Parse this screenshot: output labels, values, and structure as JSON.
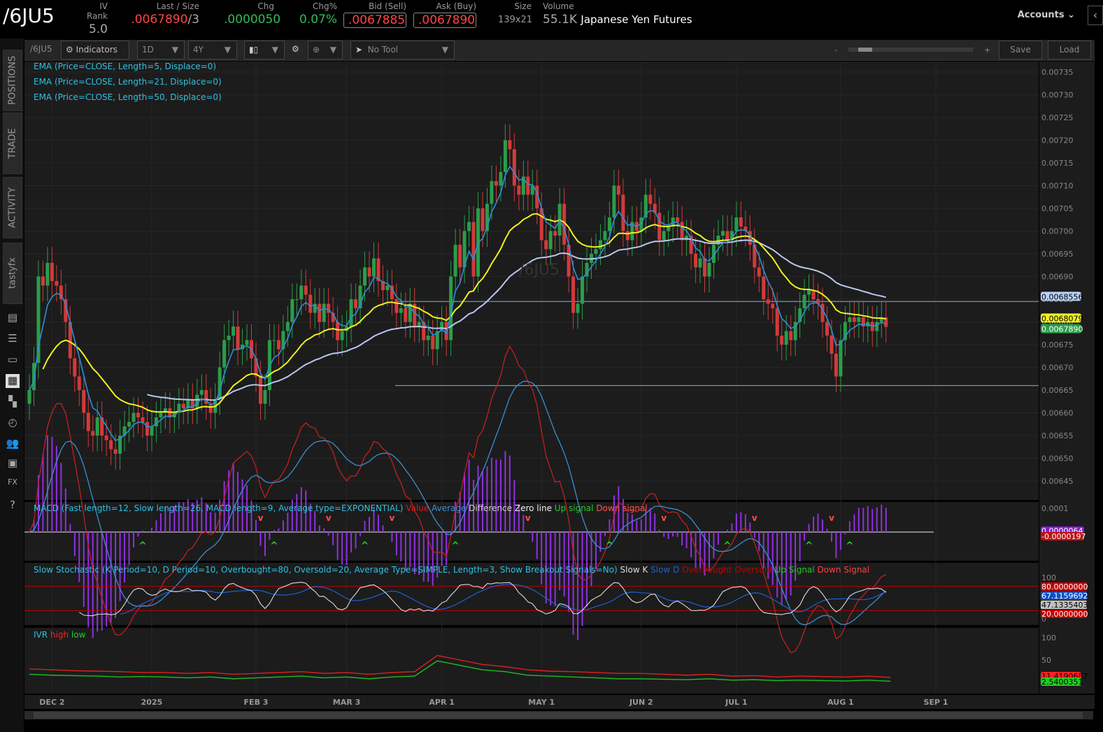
{
  "header": {
    "symbol": "/6JU5",
    "iv_rank_label": "IV Rank",
    "iv_rank": "5.0",
    "last_label": "Last / Size",
    "last": ".0067890",
    "last_size": "/3",
    "chg_label": "Chg",
    "chg": ".0000050",
    "chgp_label": "Chg%",
    "chgp": "0.07%",
    "bid_label": "Bid (Sell)",
    "bid": ".0067885",
    "ask_label": "Ask (Buy)",
    "ask": ".0067890",
    "size_label": "Size",
    "size": "139x21",
    "volume_label": "Volume",
    "volume": "55.1K",
    "description": "Japanese Yen Futures",
    "accounts": "Accounts"
  },
  "sidebar": {
    "tabs": [
      "POSITIONS",
      "TRADE",
      "ACTIVITY",
      "tastyfx"
    ],
    "icons": [
      "notes-icon",
      "list-icon",
      "monitor-icon",
      "chart-icon",
      "grid-icon",
      "clock-icon",
      "people-icon",
      "calendar-icon",
      "fx-icon",
      "help-icon"
    ]
  },
  "toolbar": {
    "symbol": "/6JU5",
    "indicators": "Indicators",
    "aggregation": "1D",
    "range": "4Y",
    "tool": "No Tool",
    "zoom_minus": "-",
    "zoom_plus": "+",
    "save": "Save",
    "load": "Load"
  },
  "studies": {
    "ema5": "EMA (Price=CLOSE, Length=5, Displace=0)",
    "ema21": "EMA (Price=CLOSE, Length=21, Displace=0)",
    "ema50": "EMA (Price=CLOSE, Length=50, Displace=0)",
    "watermark": "/6JU5"
  },
  "macd_legend": {
    "title": "MACD (Fast length=12, Slow length=26, MACD length=9, Average type=EXPONENTIAL)",
    "items": [
      {
        "t": "Value",
        "c": "#d02020"
      },
      {
        "t": "Average",
        "c": "#3a8fd0"
      },
      {
        "t": "Difference",
        "c": "#cccccc"
      },
      {
        "t": "Zero line",
        "c": "#eeeeee"
      },
      {
        "t": "Up signal",
        "c": "#22cc22"
      },
      {
        "t": "Down signal",
        "c": "#ff5050"
      }
    ]
  },
  "stoch_legend": {
    "title": "Slow Stochastic (K Period=10, D Period=10, Overbought=80, Oversold=20, Average Type=SIMPLE, Length=3, Show Breakout Signals=No)",
    "items": [
      {
        "t": "Slow K",
        "c": "#dddddd"
      },
      {
        "t": "Slow D",
        "c": "#2060d0"
      },
      {
        "t": "Overbought",
        "c": "#c00000"
      },
      {
        "t": "Oversold",
        "c": "#c00000"
      },
      {
        "t": "Up Signal",
        "c": "#22cc22"
      },
      {
        "t": "Down Signal",
        "c": "#ff4040"
      }
    ]
  },
  "ivr_legend": {
    "title": "IVR",
    "items": [
      {
        "t": "high",
        "c": "#ff2020"
      },
      {
        "t": "low",
        "c": "#22cc22"
      }
    ]
  },
  "colors": {
    "up": "#2a9d4a",
    "down": "#d23a3a",
    "ema5": "#2f8fd8",
    "ema21": "#f0f020",
    "ema50": "#b8c8f0",
    "level": "#6a9ab8"
  },
  "chart_data": {
    "type": "candlestick",
    "price_axis": {
      "ticks": [
        "0.00735",
        "0.00730",
        "0.00725",
        "0.00720",
        "0.00715",
        "0.00710",
        "0.00705",
        "0.00700",
        "0.00695",
        "0.00690",
        "0.00685",
        "0.00680",
        "0.00675",
        "0.00670",
        "0.00665",
        "0.00660",
        "0.00655",
        "0.00650",
        "0.00645"
      ],
      "range": [
        0.00641,
        0.00738
      ]
    },
    "price_labels": [
      {
        "t": "0.0068556",
        "c": "#b8d0f8",
        "v": 0.0068556
      },
      {
        "t": "0.0068079",
        "c": "#f0f020",
        "v": 0.0068079
      },
      {
        "t": "0.0067890",
        "c": "#2a9d4a",
        "v": 0.006789
      }
    ],
    "levels": [
      0.006845,
      0.00666
    ],
    "x_labels": [
      {
        "t": "DEC 2",
        "i": 5
      },
      {
        "t": "2025",
        "i": 27
      },
      {
        "t": "FEB 3",
        "i": 50
      },
      {
        "t": "MAR 3",
        "i": 70
      },
      {
        "t": "APR 1",
        "i": 91
      },
      {
        "t": "MAY 1",
        "i": 113
      },
      {
        "t": "JUN 2",
        "i": 135
      },
      {
        "t": "JUL 1",
        "i": 156
      },
      {
        "t": "AUG 1",
        "i": 179
      },
      {
        "t": "SEP 1",
        "i": 200
      }
    ],
    "closes": [
      0.00665,
      0.00671,
      0.0069,
      0.00688,
      0.00693,
      0.00689,
      0.00688,
      0.00685,
      0.0068,
      0.00672,
      0.00668,
      0.00665,
      0.0066,
      0.00656,
      0.00655,
      0.00659,
      0.00655,
      0.00654,
      0.00652,
      0.00651,
      0.00655,
      0.00657,
      0.00658,
      0.0066,
      0.00659,
      0.00658,
      0.00655,
      0.00657,
      0.00659,
      0.0066,
      0.00661,
      0.00659,
      0.0066,
      0.00662,
      0.00661,
      0.00663,
      0.00661,
      0.00664,
      0.00665,
      0.00662,
      0.0066,
      0.00663,
      0.0067,
      0.00676,
      0.00677,
      0.00679,
      0.00674,
      0.00675,
      0.00676,
      0.00672,
      0.00668,
      0.00662,
      0.00665,
      0.00676,
      0.00676,
      0.00674,
      0.00678,
      0.0068,
      0.00685,
      0.00685,
      0.00688,
      0.00686,
      0.00682,
      0.00684,
      0.0068,
      0.00684,
      0.00682,
      0.0068,
      0.00676,
      0.00678,
      0.00679,
      0.00685,
      0.00683,
      0.00688,
      0.00692,
      0.0069,
      0.00694,
      0.00689,
      0.00687,
      0.00688,
      0.00685,
      0.00682,
      0.00683,
      0.0068,
      0.00684,
      0.00679,
      0.0068,
      0.00676,
      0.00677,
      0.00674,
      0.00678,
      0.0068,
      0.00676,
      0.0069,
      0.00697,
      0.00692,
      0.007,
      0.00702,
      0.0069,
      0.00705,
      0.007,
      0.00706,
      0.00711,
      0.0071,
      0.00713,
      0.0072,
      0.00718,
      0.0071,
      0.00708,
      0.00712,
      0.00708,
      0.0071,
      0.00705,
      0.00698,
      0.00696,
      0.007,
      0.00699,
      0.00706,
      0.00697,
      0.0069,
      0.00682,
      0.00684,
      0.0069,
      0.00693,
      0.00695,
      0.00696,
      0.00698,
      0.007,
      0.00703,
      0.0071,
      0.00708,
      0.007,
      0.00698,
      0.00702,
      0.007,
      0.00703,
      0.00708,
      0.00706,
      0.00704,
      0.00698,
      0.007,
      0.00701,
      0.00703,
      0.00702,
      0.00698,
      0.00699,
      0.00695,
      0.00692,
      0.00694,
      0.0069,
      0.00693,
      0.00697,
      0.00699,
      0.007,
      0.00698,
      0.007,
      0.00703,
      0.00701,
      0.007,
      0.00697,
      0.00692,
      0.0069,
      0.00685,
      0.00684,
      0.00683,
      0.00677,
      0.00675,
      0.00678,
      0.00676,
      0.0068,
      0.00683,
      0.00686,
      0.00687,
      0.00685,
      0.00684,
      0.0068,
      0.00677,
      0.00673,
      0.00668,
      0.00676,
      0.0068,
      0.00681,
      0.0068,
      0.00681,
      0.00679,
      0.0068,
      0.00678,
      0.0068,
      0.00681,
      0.006789
    ],
    "macd_axis": {
      "ticks": [
        "0.0001"
      ],
      "labels": [
        {
          "t": "0.0000064",
          "c": "#8020d0"
        },
        {
          "t": "-0.0000197",
          "c": "#c01010"
        }
      ]
    },
    "stoch_axis": {
      "ticks": [
        "100",
        "0"
      ],
      "labels": [
        {
          "t": "80.0000000",
          "c": "#c00000"
        },
        {
          "t": "67.1159692",
          "c": "#1050c0"
        },
        {
          "t": "47.1335403",
          "c": "#c0c0c0"
        },
        {
          "t": "20.0000000",
          "c": "#c00000"
        }
      ],
      "overbought": 80,
      "oversold": 20
    },
    "ivr_axis": {
      "ticks": [
        "100",
        "50"
      ],
      "labels": [
        {
          "t": "11.4190687",
          "c": "#ff2020"
        },
        {
          "t": "2.5400351",
          "c": "#22cc22"
        }
      ]
    },
    "ivr_high": [
      30,
      28,
      26,
      25,
      24,
      22,
      22,
      20,
      22,
      18,
      20,
      22,
      24,
      20,
      22,
      18,
      22,
      24,
      60,
      50,
      40,
      35,
      28,
      25,
      24,
      22,
      20,
      20,
      18,
      16,
      18,
      14,
      15,
      12,
      14,
      13,
      12,
      14,
      11
    ],
    "ivr_low": [
      18,
      16,
      15,
      14,
      12,
      13,
      12,
      10,
      12,
      8,
      10,
      12,
      14,
      10,
      12,
      8,
      12,
      14,
      48,
      38,
      28,
      24,
      16,
      14,
      12,
      10,
      8,
      8,
      7,
      6,
      8,
      5,
      6,
      4,
      5,
      4,
      3,
      5,
      2.5
    ]
  }
}
